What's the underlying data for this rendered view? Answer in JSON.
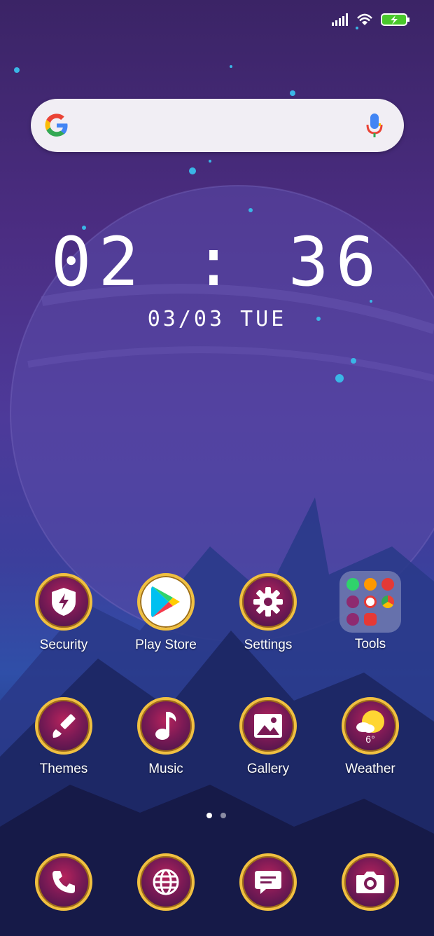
{
  "status_bar": {
    "signal_icon": "signal-icon",
    "wifi_icon": "wifi-icon",
    "battery_icon": "battery-charging-icon"
  },
  "search_bar": {
    "logo": "google-g-icon",
    "voice": "microphone-icon",
    "placeholder": ""
  },
  "clock": {
    "time": "02 : 36",
    "date": "03/03 TUE"
  },
  "apps": [
    {
      "label": "Security",
      "icon": "shield-icon"
    },
    {
      "label": "Play Store",
      "icon": "play-store-icon"
    },
    {
      "label": "Settings",
      "icon": "gear-icon"
    },
    {
      "label": "Tools",
      "icon": "folder-icon"
    },
    {
      "label": "Themes",
      "icon": "paintbrush-icon"
    },
    {
      "label": "Music",
      "icon": "music-note-icon"
    },
    {
      "label": "Gallery",
      "icon": "image-icon"
    },
    {
      "label": "Weather",
      "icon": "sun-cloud-icon",
      "value": "6°"
    }
  ],
  "page_indicator": {
    "pages": 2,
    "current": 1
  },
  "dock": [
    {
      "icon": "phone-icon"
    },
    {
      "icon": "globe-icon"
    },
    {
      "icon": "message-icon"
    },
    {
      "icon": "camera-icon"
    }
  ],
  "colors": {
    "ring": "#f0c040",
    "icon_bg": "#b6235c",
    "search_bg": "#f1eef4"
  }
}
